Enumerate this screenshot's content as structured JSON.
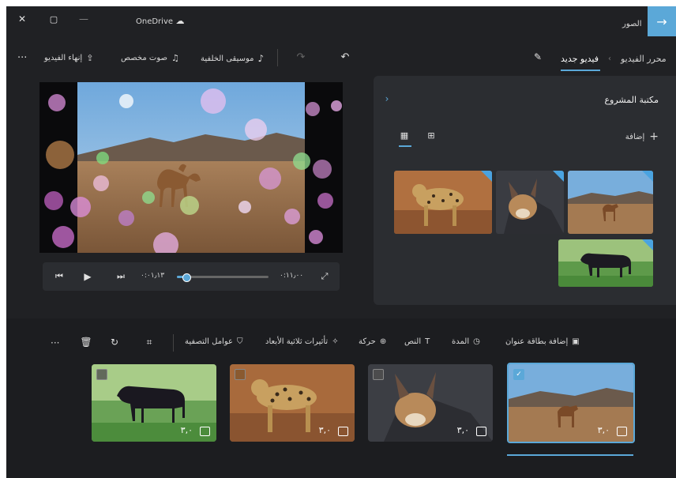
{
  "window": {
    "title": "OneDrive",
    "back_app_label": "الصور"
  },
  "toolbar": {
    "editor_label": "محرر الفيديو",
    "new_video_label": "فيديو جديد",
    "finish_label": "إنهاء الفيديو",
    "custom_audio_label": "صوت مخصص",
    "background_music_label": "موسيقى الخلفية",
    "more": "···"
  },
  "preview": {
    "time_current": "٠:٠١٫١٣",
    "time_total": "٠:١١٫٠٠",
    "progress": 0.1
  },
  "library": {
    "title": "مكتبة المشروع",
    "add_label": "إضافة"
  },
  "storyboard": {
    "add_title_card": "إضافة بطاقة عنوان",
    "duration": "المدة",
    "text": "النص",
    "motion": "حركة",
    "effects_3d": "تأثيرات ثلاثية الأبعاد",
    "filters": "عوامل التصفية",
    "more": "···",
    "cards": [
      {
        "name": "card-camel",
        "duration": "٣,٠",
        "selected": true
      },
      {
        "name": "card-caracal",
        "duration": "٣,٠",
        "selected": false
      },
      {
        "name": "card-leopard",
        "duration": "٣,٠",
        "selected": false
      },
      {
        "name": "card-horse",
        "duration": "٣,٠",
        "selected": false
      }
    ]
  },
  "colors": {
    "accent": "#5ba8d8",
    "background": "#202124",
    "panel": "#2b2d31"
  }
}
